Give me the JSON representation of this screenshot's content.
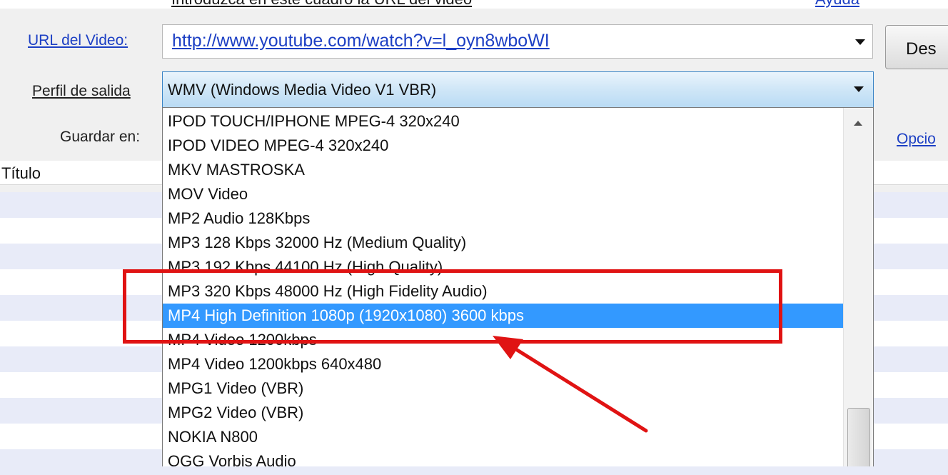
{
  "header": {
    "hint_text": "Introduzca en este cuadro la URL del video",
    "top_right_link": "Ayuda"
  },
  "form": {
    "url_label": "URL del Video:",
    "url_value": "http://www.youtube.com/watch?v=l_oyn8wboWI",
    "download_button": "Des",
    "profile_label": "Perfil de salida",
    "profile_selected": "WMV (Windows Media Video V1 VBR)",
    "save_label": "Guardar en:",
    "options_link": "Opcio"
  },
  "table": {
    "title_column": "Título"
  },
  "dropdown": {
    "selected_index": 8,
    "items": [
      "IPOD TOUCH/IPHONE MPEG-4 320x240",
      "IPOD VIDEO MPEG-4 320x240",
      "MKV MASTROSKA",
      "MOV Video",
      "MP2 Audio 128Kbps",
      "MP3 128 Kbps 32000 Hz (Medium Quality)",
      "MP3 192 Kbps 44100 Hz (High Quality)",
      "MP3 320 Kbps 48000 Hz (High Fidelity Audio)",
      "MP4 High Definition 1080p (1920x1080) 3600 kbps",
      "MP4 Video 1200kbps",
      "MP4 Video 1200kbps 640x480",
      "MPG1 Video (VBR)",
      "MPG2 Video (VBR)",
      "NOKIA N800",
      "OGG Vorbis Audio"
    ]
  },
  "annotation": {
    "highlight_color": "#e01313"
  }
}
